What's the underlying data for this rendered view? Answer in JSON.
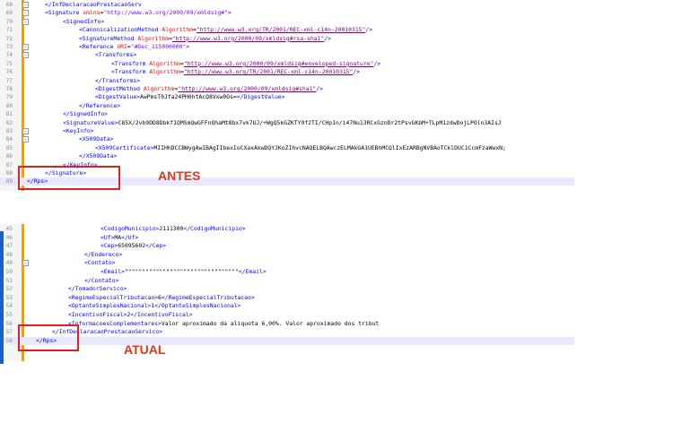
{
  "panel_top": {
    "lines": [
      {
        "num": "68",
        "fold": "-",
        "indent": 24,
        "segs": [
          [
            "t",
            "</InfDeclaracaoPrestacaoServ"
          ]
        ]
      },
      {
        "num": "69",
        "fold": "-",
        "indent": 24,
        "segs": [
          [
            "t",
            "<Signature "
          ],
          [
            "a",
            "xmlns"
          ],
          [
            "x",
            "="
          ],
          [
            "v",
            "\"http://www.w3.org/2000/09/xmldsig#\""
          ],
          [
            "t",
            ">"
          ]
        ]
      },
      {
        "num": "70",
        "fold": "-",
        "indent": 44,
        "segs": [
          [
            "t",
            "<SignedInfo>"
          ]
        ]
      },
      {
        "num": "71",
        "fold": "",
        "indent": 62,
        "segs": [
          [
            "t",
            "<CanonicalizationMethod "
          ],
          [
            "a",
            "Algorithm"
          ],
          [
            "x",
            "="
          ],
          [
            "s",
            "\"http://www.w3.org/TR/2001/REC-xml-c14n-20010315\""
          ],
          [
            "t",
            "/>"
          ]
        ]
      },
      {
        "num": "72",
        "fold": "",
        "indent": 62,
        "segs": [
          [
            "t",
            "<SignatureMethod "
          ],
          [
            "a",
            "Algorithm"
          ],
          [
            "x",
            "="
          ],
          [
            "s",
            "\"http://www.w3.org/2000/09/xmldsig#rsa-sha1\""
          ],
          [
            "t",
            "/>"
          ]
        ]
      },
      {
        "num": "73",
        "fold": "-",
        "indent": 62,
        "segs": [
          [
            "t",
            "<Reference "
          ],
          [
            "a",
            "URI"
          ],
          [
            "x",
            "="
          ],
          [
            "v",
            "\"#Dec_115000000\""
          ],
          [
            "t",
            ">"
          ]
        ]
      },
      {
        "num": "74",
        "fold": "-",
        "indent": 80,
        "segs": [
          [
            "t",
            "<Transforms>"
          ]
        ]
      },
      {
        "num": "75",
        "fold": "",
        "indent": 98,
        "segs": [
          [
            "t",
            "<Transform "
          ],
          [
            "a",
            "Algorithm"
          ],
          [
            "x",
            "="
          ],
          [
            "s",
            "\"http://www.w3.org/2000/09/xmldsig#enveloped-signature\""
          ],
          [
            "t",
            "/>"
          ]
        ]
      },
      {
        "num": "76",
        "fold": "",
        "indent": 98,
        "segs": [
          [
            "t",
            "<Transform "
          ],
          [
            "a",
            "Algorithm"
          ],
          [
            "x",
            "="
          ],
          [
            "s",
            "\"http://www.w3.org/TR/2001/REC-xml-c14n-20010315\""
          ],
          [
            "t",
            "/>"
          ]
        ]
      },
      {
        "num": "77",
        "fold": "",
        "indent": 80,
        "segs": [
          [
            "t",
            "</Transforms>"
          ]
        ]
      },
      {
        "num": "78",
        "fold": "",
        "indent": 80,
        "segs": [
          [
            "t",
            "<DigestMethod "
          ],
          [
            "a",
            "Algorithm"
          ],
          [
            "x",
            "="
          ],
          [
            "s",
            "\"http://www.w3.org/2000/09/xmldsig#sha1\""
          ],
          [
            "t",
            "/>"
          ]
        ]
      },
      {
        "num": "79",
        "fold": "",
        "indent": 80,
        "segs": [
          [
            "t",
            "<DigestValue>"
          ],
          [
            "x",
            "AwPmsT0Jfa24PH0htAcQ8Vxw0Os="
          ],
          [
            "t",
            "</DigestValue>"
          ]
        ]
      },
      {
        "num": "80",
        "fold": "",
        "indent": 62,
        "segs": [
          [
            "t",
            "</Reference>"
          ]
        ]
      },
      {
        "num": "81",
        "fold": "",
        "indent": 44,
        "segs": [
          [
            "t",
            "</SignedInfo>"
          ]
        ]
      },
      {
        "num": "82",
        "fold": "",
        "indent": 44,
        "segs": [
          [
            "t",
            "<SignatureValue>"
          ],
          [
            "x",
            "C85X/2vb9DD8Dbkf1QMSmQwGFFnQhaMt8bx7vk7UJ/+WgQ5kGZKTY9f2TI/CHp1n/i47Nu13RCxGznDr2tPsvGKbM+TLpM1zdwDojLPOln3AIsJ"
          ]
        ]
      },
      {
        "num": "83",
        "fold": "-",
        "indent": 44,
        "segs": [
          [
            "t",
            "<KeyInfo>"
          ]
        ]
      },
      {
        "num": "84",
        "fold": "-",
        "indent": 62,
        "segs": [
          [
            "t",
            "<X509Data>"
          ]
        ]
      },
      {
        "num": "85",
        "fold": "",
        "indent": 80,
        "segs": [
          [
            "t",
            "<X509Certificate>"
          ],
          [
            "x",
            "MIIHhDCCBWygAwIBAgIIbexIoCXaxAkwDQYJKoZIhvcNAQELBQAwczELMAkGA1UEBhMCQlIxEzARBgNVBAoTCklDUC1CcmFzaWwxN;"
          ]
        ]
      },
      {
        "num": "86",
        "fold": "",
        "indent": 62,
        "segs": [
          [
            "t",
            "</X509Data>"
          ]
        ]
      },
      {
        "num": "87",
        "fold": "",
        "indent": 44,
        "segs": [
          [
            "t",
            "</KeyInfo>"
          ]
        ]
      },
      {
        "num": "88",
        "fold": "",
        "indent": 24,
        "segs": [
          [
            "t",
            "</Signature>"
          ]
        ]
      },
      {
        "num": "89",
        "fold": "",
        "indent": 4,
        "segs": [
          [
            "t",
            "</Rps>"
          ]
        ]
      }
    ]
  },
  "panel_bottom": {
    "lines": [
      {
        "num": "45",
        "fold": "",
        "indent": 86,
        "segs": [
          [
            "t",
            "<CodigoMunicipio>"
          ],
          [
            "x",
            "2111300"
          ],
          [
            "t",
            "</CodigoMunicipio>"
          ]
        ]
      },
      {
        "num": "46",
        "fold": "",
        "indent": 86,
        "segs": [
          [
            "t",
            "<Uf>"
          ],
          [
            "x",
            "MA"
          ],
          [
            "t",
            "</Uf>"
          ]
        ]
      },
      {
        "num": "47",
        "fold": "",
        "indent": 86,
        "segs": [
          [
            "t",
            "<Cep>"
          ],
          [
            "x",
            "65095602"
          ],
          [
            "t",
            "</Cep>"
          ]
        ]
      },
      {
        "num": "48",
        "fold": "",
        "indent": 68,
        "segs": [
          [
            "t",
            "</Endereco>"
          ]
        ]
      },
      {
        "num": "49",
        "fold": "-",
        "indent": 68,
        "segs": [
          [
            "t",
            "<Contato>"
          ]
        ]
      },
      {
        "num": "50",
        "fold": "",
        "indent": 86,
        "segs": [
          [
            "t",
            "<Email>"
          ],
          [
            "x",
            "\"\"\"\"\"\"\"\"\"\"\"\"\"\"\"\"\"\"\"\"\"\"\"\"\"\"\"\"\"\"\"\"\""
          ],
          [
            "t",
            "</Email>"
          ]
        ]
      },
      {
        "num": "51",
        "fold": "",
        "indent": 68,
        "segs": [
          [
            "t",
            "</Contato>"
          ]
        ]
      },
      {
        "num": "52",
        "fold": "",
        "indent": 50,
        "segs": [
          [
            "t",
            "</TomadorServico>"
          ]
        ]
      },
      {
        "num": "53",
        "fold": "",
        "indent": 50,
        "segs": [
          [
            "t",
            "<RegimeEspecialTributacao>"
          ],
          [
            "x",
            "6"
          ],
          [
            "t",
            "</RegimeEspecialTributacao>"
          ]
        ]
      },
      {
        "num": "54",
        "fold": "",
        "indent": 50,
        "segs": [
          [
            "t",
            "<OptanteSimplesNacional>"
          ],
          [
            "x",
            "1"
          ],
          [
            "t",
            "</OptanteSimplesNacional>"
          ]
        ]
      },
      {
        "num": "55",
        "fold": "",
        "indent": 50,
        "segs": [
          [
            "t",
            "<IncentivoFiscal>"
          ],
          [
            "x",
            "2"
          ],
          [
            "t",
            "</IncentivoFiscal>"
          ]
        ]
      },
      {
        "num": "56",
        "fold": "",
        "indent": 50,
        "segs": [
          [
            "t",
            "<InformacoesComplementares>"
          ],
          [
            "x",
            "Valor aproximado da aliquota 6,00%. Valor aproximado dos tribut"
          ]
        ]
      },
      {
        "num": "57",
        "fold": "",
        "indent": 32,
        "segs": [
          [
            "t",
            "</InfDeclaracaoPrestacaoServico>"
          ]
        ]
      },
      {
        "num": "58",
        "fold": "",
        "indent": 14,
        "segs": [
          [
            "t",
            "</Rps>"
          ]
        ]
      }
    ]
  },
  "labels": {
    "antes": "ANTES",
    "atual": "ATUAL"
  },
  "colors": {
    "tag": "#0000ff",
    "attribute": "#ff0000",
    "value": "#8000ff",
    "highlight_box": "#e02020",
    "label": "#d9381e"
  }
}
